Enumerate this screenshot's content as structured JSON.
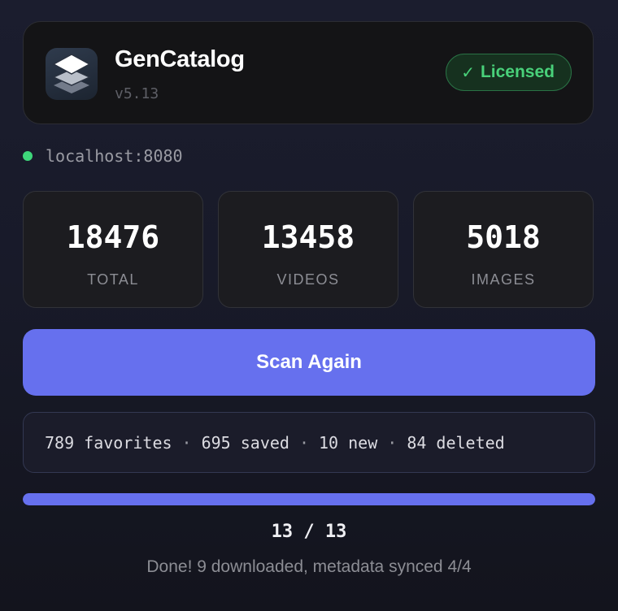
{
  "app": {
    "name": "GenCatalog",
    "version": "v5.13",
    "logo_icon": "stacked-layers-icon",
    "license": {
      "icon": "checkmark-icon",
      "check": "✓",
      "label": "Licensed"
    }
  },
  "server": {
    "host": "localhost:8080",
    "status_color": "#3ed67a"
  },
  "stats": [
    {
      "value": "18476",
      "label": "TOTAL"
    },
    {
      "value": "13458",
      "label": "VIDEOS"
    },
    {
      "value": "5018",
      "label": "IMAGES"
    }
  ],
  "scan_button": {
    "label": "Scan Again"
  },
  "summary": {
    "favorites": "789 favorites",
    "saved": "695 saved",
    "new": "10 new",
    "deleted": "84 deleted",
    "separator": "·"
  },
  "progress": {
    "current": 13,
    "total": 13,
    "fraction": 1.0,
    "label": "13 / 13"
  },
  "status_message": "Done! 9 downloaded, metadata synced 4/4",
  "colors": {
    "accent": "#6670ee",
    "success": "#49d17a",
    "background": "#181a29"
  }
}
